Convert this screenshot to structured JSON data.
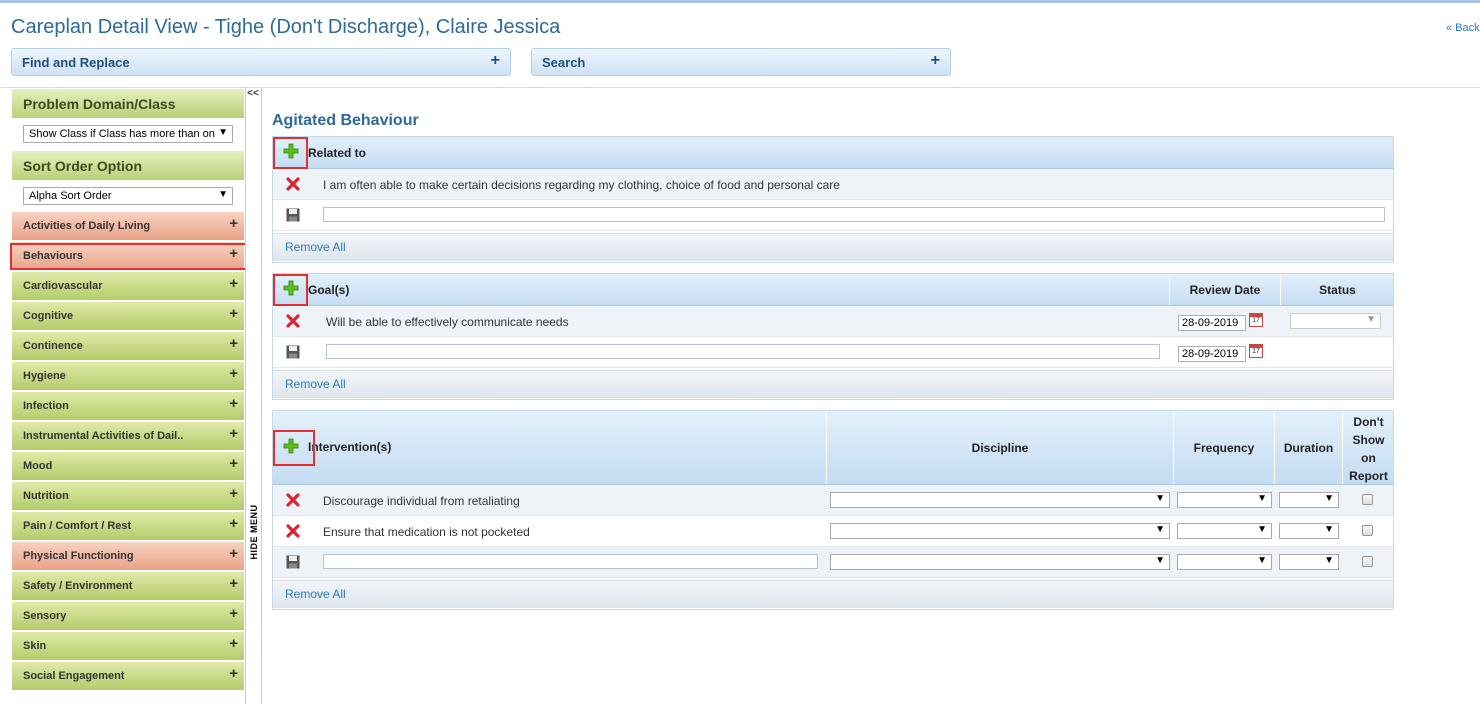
{
  "header": {
    "title": "Careplan Detail View - Tighe (Don't Discharge), Claire Jessica",
    "back_label": "« Back"
  },
  "bars": {
    "find_replace": "Find and Replace",
    "search": "Search",
    "expand_icon": "+"
  },
  "sidebar": {
    "problem_domain_heading": "Problem Domain/Class",
    "class_filter": "Show Class if Class has more than on",
    "sort_heading": "Sort Order Option",
    "sort_value": "Alpha Sort Order",
    "collapse_label": "<<",
    "hide_menu_label": "HIDE MENU",
    "items": [
      {
        "label": "Activities of Daily Living"
      },
      {
        "label": "Behaviours"
      },
      {
        "label": "Cardiovascular"
      },
      {
        "label": "Cognitive"
      },
      {
        "label": "Continence"
      },
      {
        "label": "Hygiene"
      },
      {
        "label": "Infection"
      },
      {
        "label": "Instrumental Activities of Dail.."
      },
      {
        "label": "Mood"
      },
      {
        "label": "Nutrition"
      },
      {
        "label": "Pain / Comfort / Rest"
      },
      {
        "label": "Physical Functioning"
      },
      {
        "label": "Safety / Environment"
      },
      {
        "label": "Sensory"
      },
      {
        "label": "Skin"
      },
      {
        "label": "Social Engagement"
      }
    ],
    "plus": "+"
  },
  "main": {
    "section_title": "Agitated Behaviour",
    "related": {
      "header": "Related to",
      "rows": [
        "I am often able to make certain decisions regarding my clothing, choice of food and personal care"
      ],
      "remove_all": "Remove All"
    },
    "goals": {
      "header": "Goal(s)",
      "review_date_header": "Review Date",
      "status_header": "Status",
      "rows": [
        {
          "text": "Will be able to effectively communicate needs",
          "date": "28-09-2019"
        }
      ],
      "new_date": "28-09-2019",
      "remove_all": "Remove All"
    },
    "interventions": {
      "header": "Intervention(s)",
      "discipline_header": "Discipline",
      "frequency_header": "Frequency",
      "duration_header": "Duration",
      "dont_show_header": "Don't Show on Report",
      "rows": [
        "Discourage individual from retaliating",
        "Ensure that medication is not pocketed"
      ],
      "remove_all": "Remove All"
    },
    "calendar_day": "17"
  },
  "colors": {
    "title": "#2e6a9a",
    "highlight": "#e03030",
    "green_item": "#b4cc6a",
    "orange_item": "#e8a287"
  }
}
